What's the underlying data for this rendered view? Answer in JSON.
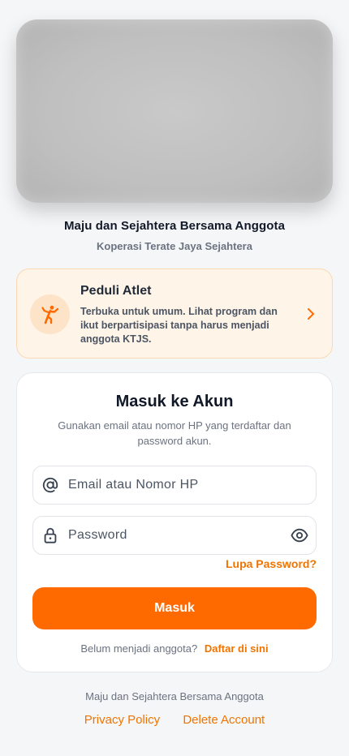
{
  "hero": {
    "image": "blurred-banner"
  },
  "header": {
    "tagline": "Maju dan Sejahtera Bersama Anggota",
    "organization": "Koperasi Terate Jaya Sejahtera"
  },
  "promo": {
    "icon": "athlete-kick-icon",
    "title": "Peduli Atlet",
    "description": "Terbuka untuk umum. Lihat program dan ikut berpartisipasi tanpa harus menjadi anggota KTJS.",
    "accent": "#ff6a00"
  },
  "login": {
    "title": "Masuk ke Akun",
    "subtitle": "Gunakan email atau nomor HP yang terdaftar dan password akun.",
    "email_placeholder": "Email atau Nomor HP",
    "email_value": "",
    "password_placeholder": "Password",
    "password_value": "",
    "forgot_label": "Lupa Password?",
    "submit_label": "Masuk",
    "register_question": "Belum menjadi anggota?",
    "register_link": "Daftar di sini"
  },
  "footer": {
    "tagline": "Maju dan Sejahtera Bersama Anggota",
    "privacy_label": "Privacy Policy",
    "delete_label": "Delete Account"
  },
  "colors": {
    "primary": "#ff6a00",
    "link": "#f07400",
    "promo_bg": "#fff4e8",
    "page_bg": "#f5f6f8"
  }
}
